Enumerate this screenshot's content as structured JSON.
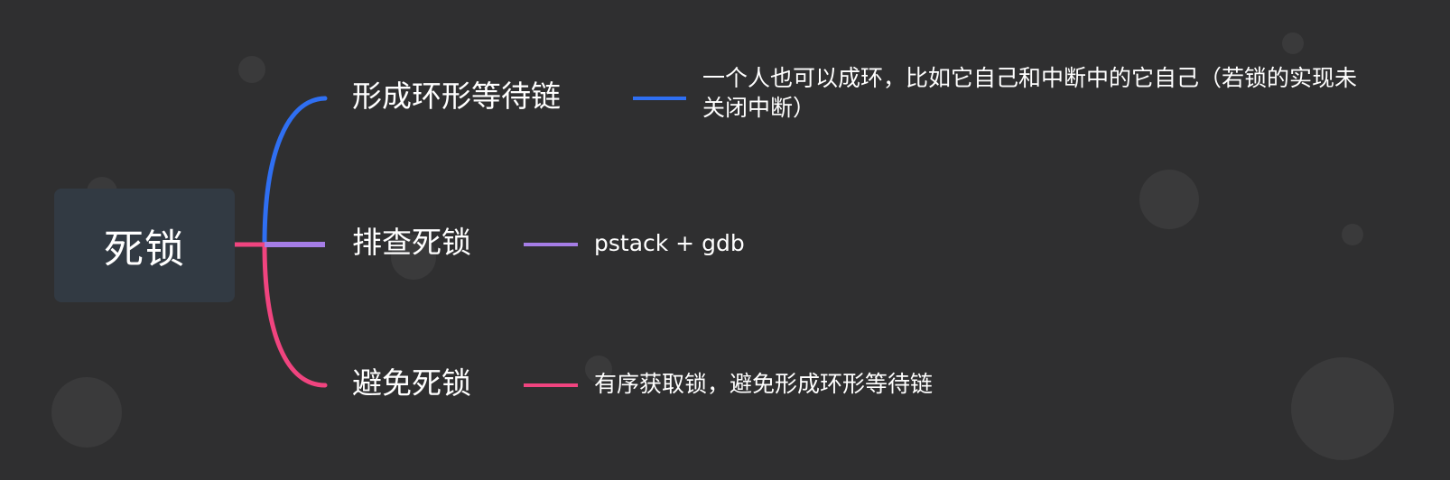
{
  "root": {
    "label": "死锁"
  },
  "branches": [
    {
      "label": "形成环形等待链",
      "color": "#2f6ff2",
      "note": "一个人也可以成环，比如它自己和中断中的它自己（若锁的实现未关闭中断）"
    },
    {
      "label": "排查死锁",
      "color": "#a57de6",
      "note": "pstack + gdb"
    },
    {
      "label": "避免死锁",
      "color": "#f0447f",
      "note": "有序获取锁，避免形成环形等待链"
    }
  ]
}
